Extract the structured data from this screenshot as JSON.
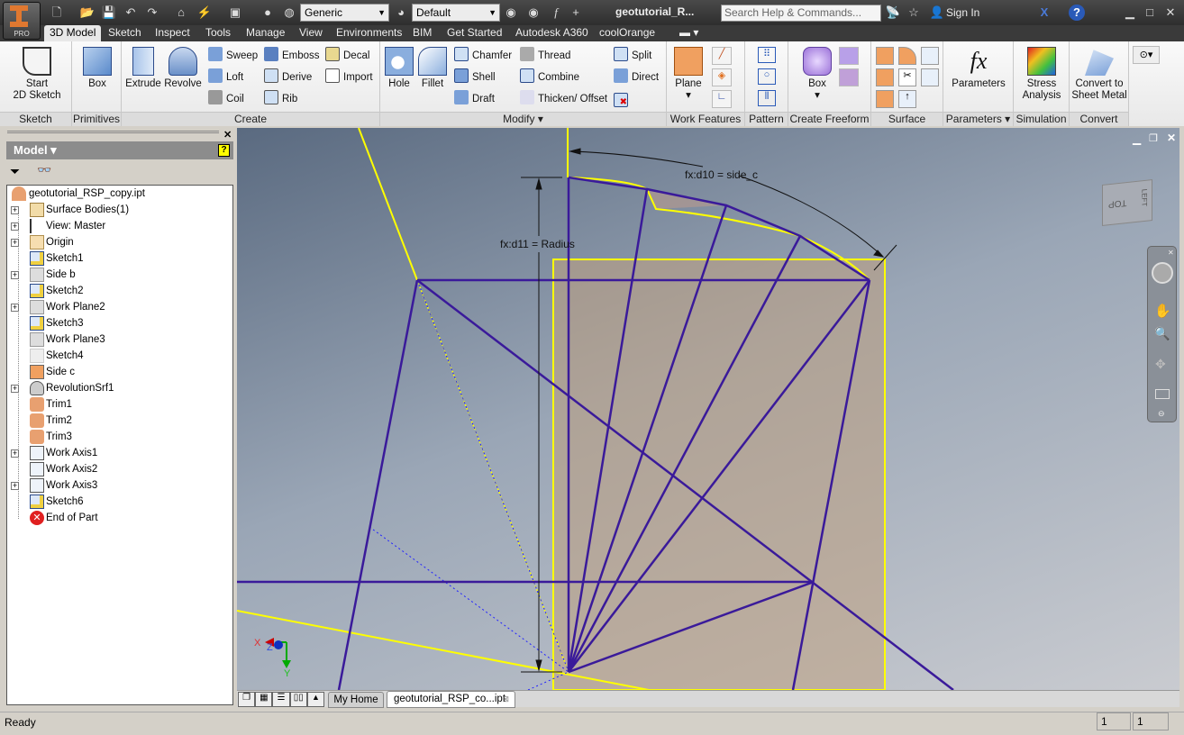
{
  "app": {
    "badge": "PRO",
    "doc_title": "geotutorial_R...",
    "search_placeholder": "Search Help & Commands...",
    "sign_in": "Sign In"
  },
  "quick_access": {
    "material": "Generic",
    "appearance": "Default"
  },
  "tabs": [
    "3D Model",
    "Sketch",
    "Inspect",
    "Tools",
    "Manage",
    "View",
    "Environments",
    "BIM",
    "Get Started",
    "Autodesk A360",
    "coolOrange"
  ],
  "active_tab": "3D Model",
  "ribbon": {
    "sketch": {
      "label": "Sketch",
      "start": "Start\n2D Sketch"
    },
    "primitives": {
      "label": "Primitives",
      "box": "Box"
    },
    "create": {
      "label": "Create",
      "extrude": "Extrude",
      "revolve": "Revolve",
      "sweep": "Sweep",
      "loft": "Loft",
      "coil": "Coil",
      "emboss": "Emboss",
      "derive": "Derive",
      "rib": "Rib",
      "decal": "Decal",
      "import": "Import"
    },
    "modify": {
      "label": "Modify ▾",
      "hole": "Hole",
      "fillet": "Fillet",
      "chamfer": "Chamfer",
      "shell": "Shell",
      "draft": "Draft",
      "thread": "Thread",
      "combine": "Combine",
      "thicken": "Thicken/ Offset",
      "split": "Split",
      "direct": "Direct"
    },
    "work_features": {
      "label": "Work Features",
      "plane": "Plane"
    },
    "pattern": {
      "label": "Pattern"
    },
    "freeform": {
      "label": "Create Freeform",
      "box": "Box"
    },
    "surface": {
      "label": "Surface"
    },
    "parameters": {
      "label": "Parameters ▾",
      "btn": "Parameters"
    },
    "simulation": {
      "label": "Simulation",
      "btn": "Stress\nAnalysis"
    },
    "convert": {
      "label": "Convert",
      "btn": "Convert to\nSheet Metal"
    }
  },
  "browser": {
    "title": "Model ▾",
    "items": [
      {
        "label": "geotutorial_RSP_copy.ipt",
        "expand": false,
        "icon": "part"
      },
      {
        "label": "Surface Bodies(1)",
        "expand": true,
        "icon": "folder-surface"
      },
      {
        "label": "View: Master",
        "expand": true,
        "icon": "view"
      },
      {
        "label": "Origin",
        "expand": true,
        "icon": "folder"
      },
      {
        "label": "Sketch1",
        "expand": false,
        "icon": "sketch"
      },
      {
        "label": "Side b",
        "expand": true,
        "icon": "plane"
      },
      {
        "label": "Sketch2",
        "expand": false,
        "icon": "sketch"
      },
      {
        "label": "Work Plane2",
        "expand": true,
        "icon": "plane"
      },
      {
        "label": "Sketch3",
        "expand": false,
        "icon": "sketch"
      },
      {
        "label": "Work Plane3",
        "expand": false,
        "icon": "plane"
      },
      {
        "label": "Sketch4",
        "expand": false,
        "icon": "sketch-hidden"
      },
      {
        "label": "Side c",
        "expand": false,
        "icon": "plane-orange"
      },
      {
        "label": "RevolutionSrf1",
        "expand": true,
        "icon": "revolve"
      },
      {
        "label": "Trim1",
        "expand": false,
        "icon": "trim"
      },
      {
        "label": "Trim2",
        "expand": false,
        "icon": "trim"
      },
      {
        "label": "Trim3",
        "expand": false,
        "icon": "trim"
      },
      {
        "label": "Work Axis1",
        "expand": true,
        "icon": "axis"
      },
      {
        "label": "Work Axis2",
        "expand": false,
        "icon": "axis"
      },
      {
        "label": "Work Axis3",
        "expand": true,
        "icon": "axis"
      },
      {
        "label": "Sketch6",
        "expand": false,
        "icon": "sketch"
      },
      {
        "label": "End of Part",
        "expand": false,
        "icon": "end"
      }
    ]
  },
  "viewport": {
    "dim_angle": "fx:d10 = side_c",
    "dim_radius": "fx:d11 = Radius",
    "viewcube_face": "TOP",
    "viewcube_side": "LEFT",
    "axis_x": "X",
    "axis_y": "Y",
    "axis_z": "Z"
  },
  "doc_tabs": [
    "My Home",
    "geotutorial_RSP_co...ipt"
  ],
  "status": {
    "text": "Ready",
    "c1": "1",
    "c2": "1"
  },
  "colors": {
    "accent": "#e07830",
    "sketch": "#3a1a9a",
    "highlight": "#ffff00",
    "face": "#b8a090"
  }
}
